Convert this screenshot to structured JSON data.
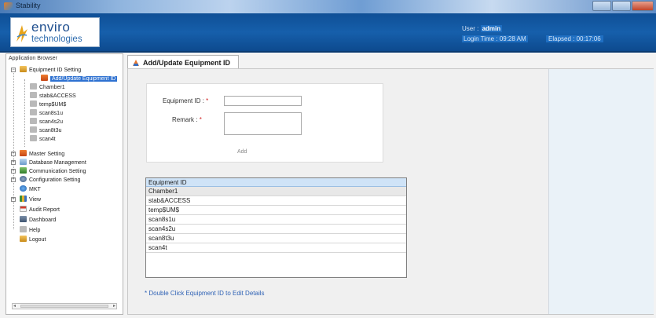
{
  "window": {
    "title": "Stability"
  },
  "header": {
    "logo": {
      "word1": "enviro",
      "word2": "technologies"
    },
    "user_label": "User :",
    "user_value": "admin",
    "login_label": "Login Time :",
    "login_value": "09:28 AM",
    "elapsed_label": "Elapsed :",
    "elapsed_value": "00:17:06"
  },
  "sidebar": {
    "title": "Application Browser",
    "items": [
      {
        "label": "Equipment ID Setting",
        "icon": "equipment-folder-icon"
      },
      {
        "label": "Add/Update Equipment ID",
        "icon": "add-icon"
      },
      {
        "label": "Chamber1",
        "icon": "equipment-icon"
      },
      {
        "label": "stab&ACCESS",
        "icon": "equipment-icon"
      },
      {
        "label": "temp$UM$",
        "icon": "equipment-icon"
      },
      {
        "label": "scan8s1u",
        "icon": "equipment-icon"
      },
      {
        "label": "scan4s2u",
        "icon": "equipment-icon"
      },
      {
        "label": "scan8t3u",
        "icon": "equipment-icon"
      },
      {
        "label": "scan4t",
        "icon": "equipment-icon"
      },
      {
        "label": "Master Setting",
        "icon": "master-icon"
      },
      {
        "label": "Database Management",
        "icon": "database-icon"
      },
      {
        "label": "Communication Setting",
        "icon": "communication-icon"
      },
      {
        "label": "Configuration Setting",
        "icon": "configuration-icon"
      },
      {
        "label": "MKT",
        "icon": "mkt-icon"
      },
      {
        "label": "View",
        "icon": "view-icon"
      },
      {
        "label": "Audit Report",
        "icon": "report-icon"
      },
      {
        "label": "Dashboard",
        "icon": "dashboard-icon"
      },
      {
        "label": "Help",
        "icon": "help-icon"
      },
      {
        "label": "Logout",
        "icon": "logout-icon"
      }
    ]
  },
  "tab": {
    "label": "Add/Update Equipment ID"
  },
  "form": {
    "equipment_label": "Equipment ID :",
    "equipment_value": "",
    "remark_label": "Remark :",
    "remark_value": "",
    "required_mark": "*",
    "add_label": "Add"
  },
  "grid": {
    "header": "Equipment ID",
    "rows": [
      "Chamber1",
      "stab&ACCESS",
      "temp$UM$",
      "scan8s1u",
      "scan4s2u",
      "scan8t3u",
      "scan4t"
    ]
  },
  "hint": "* Double Click Equipment ID to Edit  Details",
  "colors": {
    "header_blue": "#165fab",
    "selection_blue": "#2f72d1",
    "grid_header": "#cfe3f7",
    "hint_blue": "#2f62b5",
    "required_red": "#d02020"
  }
}
